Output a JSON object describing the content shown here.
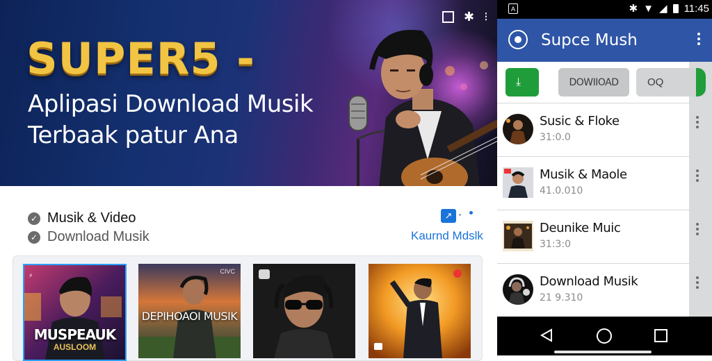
{
  "hero": {
    "title": "SUPER5 -",
    "subtitle_line1": "Aplipasi Download Musik",
    "subtitle_line2": "Terbaak patur Ana",
    "icons": [
      "square-icon",
      "bluetooth-icon",
      "share-icon"
    ]
  },
  "features": [
    {
      "label": "Musik & Video",
      "icon": "check-circle-icon"
    },
    {
      "label": "Download Musik",
      "icon": "check-circle-icon"
    }
  ],
  "kaurnd": {
    "label": "Kaurnd Mdslk",
    "icon": "chart-icon"
  },
  "albums": [
    {
      "caption": "MUSPEAUK",
      "sub": "AUSLOOM",
      "selected": true
    },
    {
      "caption": "DEPIHOAOI MUSIK",
      "tag": "CIVC"
    },
    {
      "caption": ""
    },
    {
      "caption": ""
    }
  ],
  "phone": {
    "status": {
      "time": "11:45"
    },
    "app_title": "Supce Mush",
    "buttons": {
      "download": "DOWIIOAD",
      "second": "OQ"
    },
    "tracks": [
      {
        "title": "Susic & Floke",
        "meta": "31:0.0"
      },
      {
        "title": "Musik & Maole",
        "meta": "41.0.010"
      },
      {
        "title": "Deunike Muic",
        "meta": "31:3:0"
      },
      {
        "title": "Download Musik",
        "meta": "21 9.310"
      }
    ]
  },
  "colors": {
    "accent": "#2e55a6",
    "gold": "#f2c443",
    "green": "#1f9d3a",
    "link": "#1a73d9"
  }
}
